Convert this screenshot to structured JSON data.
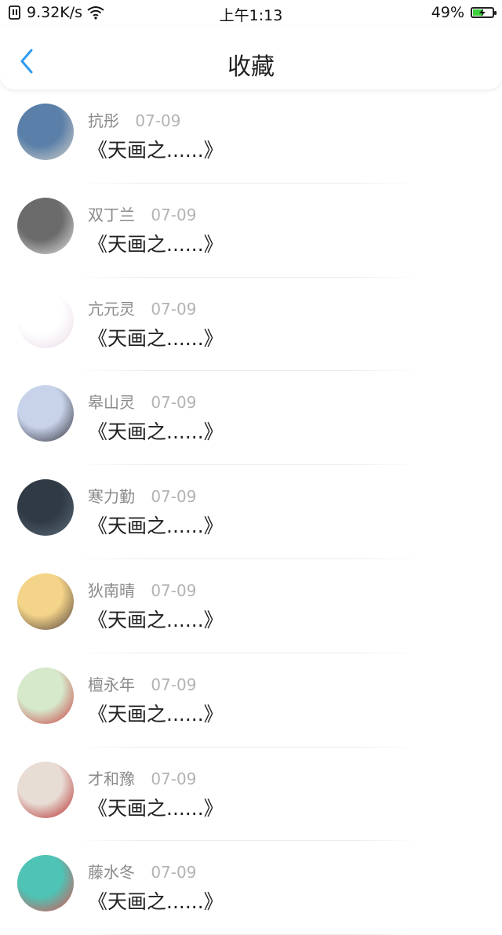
{
  "status_bar": {
    "net_speed": "9.32K/s",
    "time": "上午1:13",
    "battery": "49%",
    "battery_level": 0.49
  },
  "header": {
    "title": "收藏"
  },
  "items": [
    {
      "name": "抗彤",
      "date": "07-09",
      "title": "《天画之......》",
      "avatar_colors": [
        "#5a7fa8",
        "#d9d4cc"
      ]
    },
    {
      "name": "双丁兰",
      "date": "07-09",
      "title": "《天画之......》",
      "avatar_colors": [
        "#6b6b6b",
        "#e6e6e6"
      ]
    },
    {
      "name": "亢元灵",
      "date": "07-09",
      "title": "《天画之......》",
      "avatar_colors": [
        "#ffffff",
        "#e9d8e6"
      ]
    },
    {
      "name": "皋山灵",
      "date": "07-09",
      "title": "《天画之......》",
      "avatar_colors": [
        "#c8d3ea",
        "#2b2b35"
      ]
    },
    {
      "name": "寒力勤",
      "date": "07-09",
      "title": "《天画之......》",
      "avatar_colors": [
        "#2f3a44",
        "#5e6f7c"
      ]
    },
    {
      "name": "狄南晴",
      "date": "07-09",
      "title": "《天画之......》",
      "avatar_colors": [
        "#f4d488",
        "#4b3a3a"
      ]
    },
    {
      "name": "檀永年",
      "date": "07-09",
      "title": "《天画之......》",
      "avatar_colors": [
        "#d6eacb",
        "#c8343c"
      ]
    },
    {
      "name": "才和豫",
      "date": "07-09",
      "title": "《天画之......》",
      "avatar_colors": [
        "#e8ddd5",
        "#b32222"
      ]
    },
    {
      "name": "藤水冬",
      "date": "07-09",
      "title": "《天画之......》",
      "avatar_colors": [
        "#4fc3b5",
        "#e94b4b"
      ]
    }
  ]
}
